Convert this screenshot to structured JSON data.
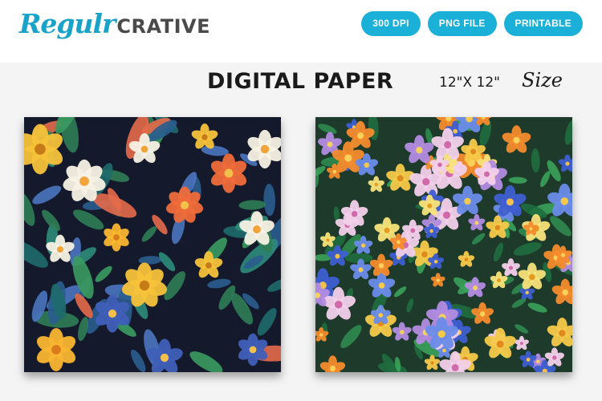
{
  "brand": {
    "script": "Regulr",
    "bold": "CRATIVE"
  },
  "badges": [
    "300 DPI",
    "PNG FILE",
    "PRINTABLE"
  ],
  "title": "DIGITAL PAPER",
  "size": {
    "dims": "12\"X 12\"",
    "word": "Size"
  },
  "colors": {
    "accent": "#1ab0d8",
    "logo_script": "#1aa3c9",
    "logo_bold": "#4a4a4a"
  },
  "papers": [
    {
      "name": "dark floral pattern",
      "background": "#141a2c"
    },
    {
      "name": "colorful flower pattern",
      "background": "#1e3a2a"
    }
  ]
}
